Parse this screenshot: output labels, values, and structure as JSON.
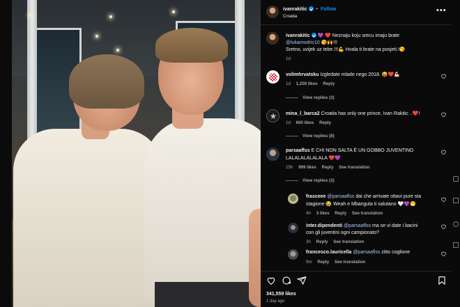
{
  "post": {
    "author": "ivanrakitic",
    "follow_label": "Follow",
    "location": "Croatia",
    "caption_author": "ivanrakitic",
    "caption_line1": "💜 ❤️ Neznaju koju srecu imaju brate",
    "caption_mention": "@lukamodric10",
    "caption_line2_tail": "😘🙌!!!",
    "caption_line3": "Sretno, uvijek uz tebe.!!!💪 Hvala ti brate na posjeti.!😘",
    "caption_age": "1d"
  },
  "comments": [
    {
      "user": "volimhrvatsku",
      "text": "Izgledate mlade nego 2018. 😝❤️💪🏻",
      "age": "1d",
      "likes": "1,259 likes",
      "reply": "Reply",
      "view_replies": "View replies (3)"
    },
    {
      "user": "mina_l_barca2",
      "text": "Croatia has only one prince, Ivan Rakitic ..❤️!",
      "age": "1d",
      "likes": "600 likes",
      "reply": "Reply",
      "view_replies": "View replies (8)"
    },
    {
      "user": "parsaaflss",
      "text_line1": "E CHI NON SALTA È UN GOBBO JUVENTINO",
      "text_line2": "LALALALALALALA ❤️💜",
      "age": "15h",
      "likes": "999 likes",
      "reply": "Reply",
      "see_translation": "See translation",
      "view_replies": "View replies (3)",
      "replies": [
        {
          "user": "frasceee",
          "mention": "@parsaaflss",
          "text_line1": "dai che arrivate ottavi pure sta",
          "text_line2": "stagione 😂 Weah e Mbangula ti salutano 🤍💜😁",
          "age": "4h",
          "likes": "3 likes",
          "reply": "Reply",
          "see_translation": "See translation"
        },
        {
          "user": "inter.dipendenti",
          "mention": "@parsaaflss",
          "text_line1": "ma se vi date i bacini",
          "text_line2": "con gli juventini ogni campionato?",
          "age": "3h",
          "reply": "Reply",
          "see_translation": "See translation"
        },
        {
          "user": "francesco.lauricella",
          "mention": "@parsaaflss",
          "text_line1": "zitto coglione",
          "age": "9m",
          "reply": "Reply",
          "see_translation": "See translation"
        }
      ]
    }
  ],
  "footer": {
    "likes": "341,559 likes",
    "age": "1 day ago"
  },
  "icons": [
    "heart-icon",
    "comment-icon",
    "share-icon",
    "bookmark-icon",
    "more-icon",
    "verified-icon"
  ]
}
